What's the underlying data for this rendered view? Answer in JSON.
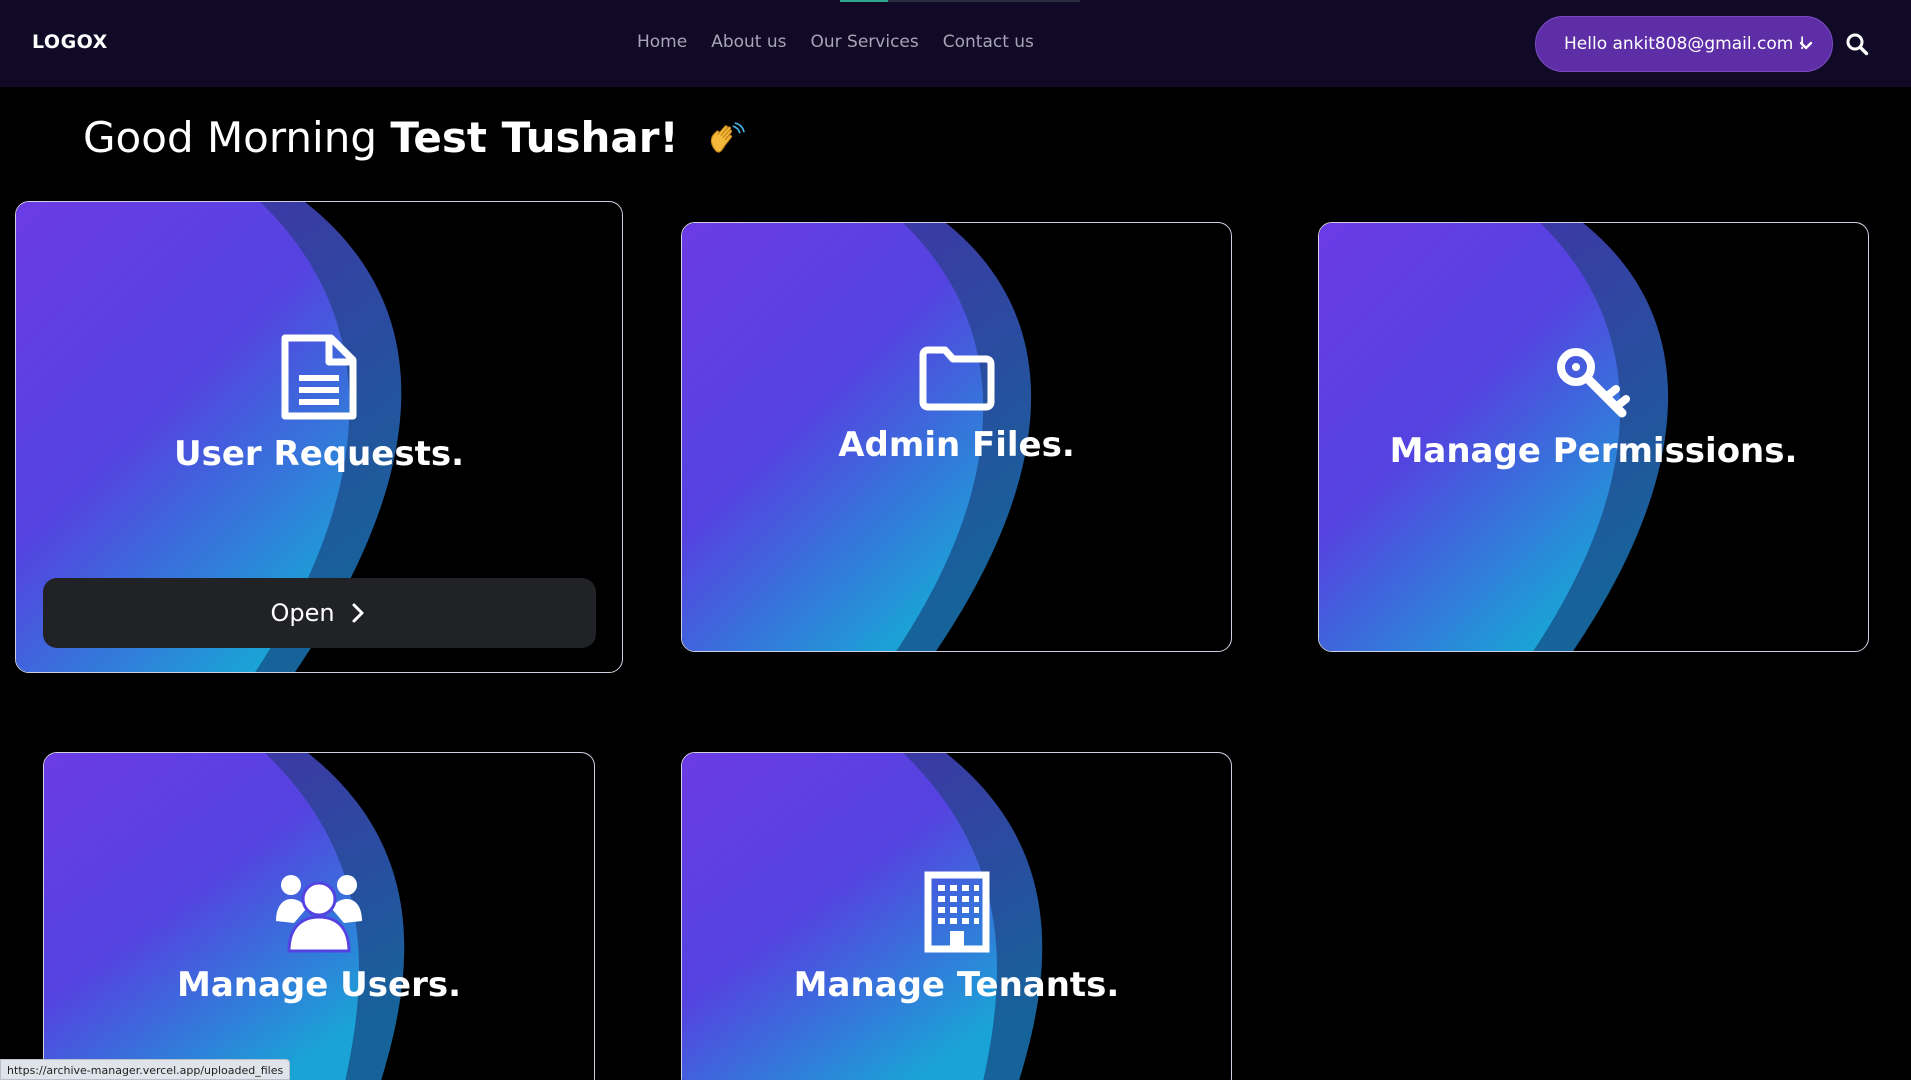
{
  "navbar": {
    "logo": "LOGOX",
    "links": [
      "Home",
      "About us",
      "Our Services",
      "Contact us"
    ],
    "user_button": "Hello ankit808@gmail.com !"
  },
  "greeting": {
    "prefix": "Good Morning",
    "name": "Test Tushar!"
  },
  "cards": [
    {
      "title": "User Requests.",
      "icon": "document-icon",
      "button": "Open"
    },
    {
      "title": "Admin Files.",
      "icon": "folder-icon"
    },
    {
      "title": "Manage Permissions.",
      "icon": "key-icon"
    },
    {
      "title": "Manage Users.",
      "icon": "users-icon"
    },
    {
      "title": "Manage Tenants.",
      "icon": "building-icon"
    }
  ],
  "status_bar": {
    "url": "https://archive-manager.vercel.app/uploaded_files"
  },
  "colors": {
    "navbar_bg": "#110a26",
    "user_button_bg": "#5e2ea6",
    "card_gradient_top": "#6a3de6",
    "card_gradient_bottom": "#1f9fd8",
    "open_button_bg": "#202226"
  }
}
